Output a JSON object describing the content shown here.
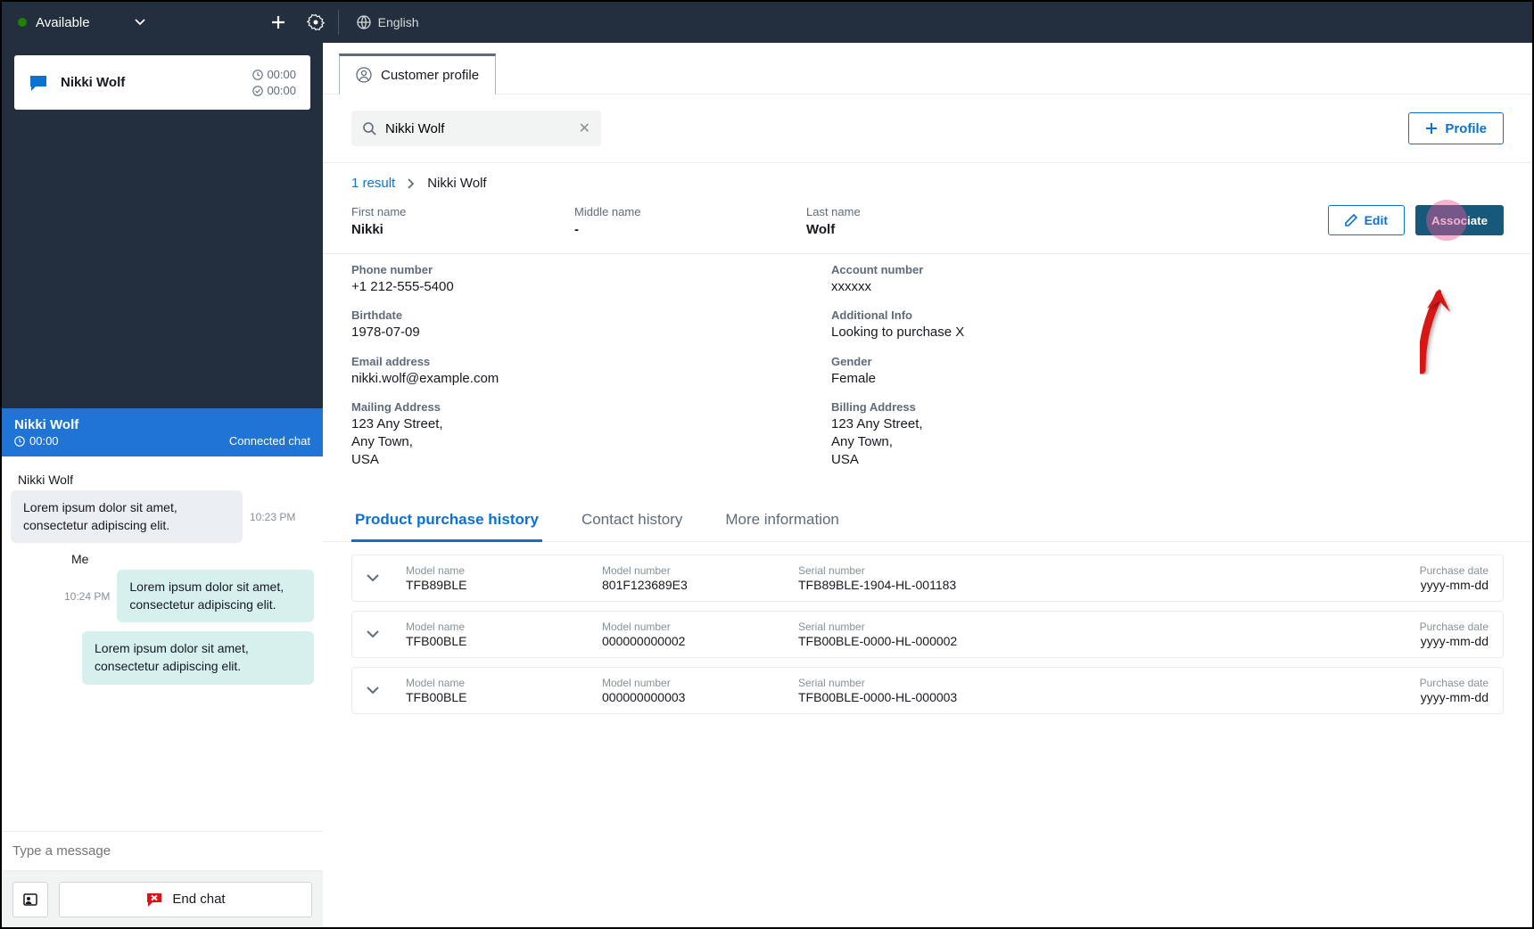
{
  "topbar": {
    "status": "Available",
    "language": "English"
  },
  "contact": {
    "name": "Nikki Wolf",
    "timer1": "00:00",
    "timer2": "00:00"
  },
  "connected": {
    "name": "Nikki Wolf",
    "timer": "00:00",
    "status": "Connected chat"
  },
  "chat": {
    "them_name": "Nikki Wolf",
    "them_msg": "Lorem ipsum dolor sit amet, consectetur adipiscing elit.",
    "them_ts": "10:23 PM",
    "me_label": "Me",
    "me_msg1": "Lorem ipsum dolor sit amet, consectetur adipiscing elit.",
    "me_msg2": "Lorem ipsum dolor sit amet, consectetur adipiscing elit.",
    "me_ts": "10:24 PM",
    "placeholder": "Type a message",
    "end_chat": "End chat"
  },
  "profile": {
    "tab": "Customer profile",
    "search_value": "Nikki Wolf",
    "profile_btn": "Profile",
    "results": "1 result",
    "crumb_name": "Nikki Wolf",
    "first_name_label": "First name",
    "first_name": "Nikki",
    "middle_name_label": "Middle name",
    "middle_name": "-",
    "last_name_label": "Last name",
    "last_name": "Wolf",
    "edit_btn": "Edit",
    "associate_btn": "Associate",
    "phone_label": "Phone number",
    "phone": "+1 212-555-5400",
    "account_label": "Account number",
    "account": "xxxxxx",
    "birth_label": "Birthdate",
    "birth": "1978-07-09",
    "addl_label": "Additional Info",
    "addl": "Looking to purchase X",
    "email_label": "Email address",
    "email": "nikki.wolf@example.com",
    "gender_label": "Gender",
    "gender": "Female",
    "mail_label": "Mailing Address",
    "mail_l1": "123 Any Street,",
    "mail_l2": "Any Town,",
    "mail_l3": "USA",
    "bill_label": "Billing Address",
    "bill_l1": "123 Any Street,",
    "bill_l2": "Any Town,",
    "bill_l3": "USA",
    "tab1": "Product purchase history",
    "tab2": "Contact history",
    "tab3": "More information",
    "hdr_model_name": "Model name",
    "hdr_model_number": "Model number",
    "hdr_serial": "Serial number",
    "hdr_date": "Purchase date",
    "rows": [
      {
        "name": "TFB89BLE",
        "number": "801F123689E3",
        "serial": "TFB89BLE-1904-HL-001183",
        "date": "yyyy-mm-dd"
      },
      {
        "name": "TFB00BLE",
        "number": "000000000002",
        "serial": "TFB00BLE-0000-HL-000002",
        "date": "yyyy-mm-dd"
      },
      {
        "name": "TFB00BLE",
        "number": "000000000003",
        "serial": "TFB00BLE-0000-HL-000003",
        "date": "yyyy-mm-dd"
      }
    ]
  }
}
